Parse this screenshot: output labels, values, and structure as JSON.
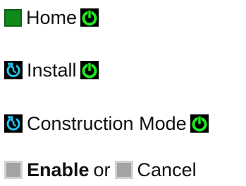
{
  "rows": [
    {
      "label": "Home"
    },
    {
      "label": "Install"
    },
    {
      "label": "Construction Mode"
    }
  ],
  "actions": {
    "enable": "Enable",
    "or": "or",
    "cancel": "Cancel"
  },
  "colors": {
    "status_green": "#118a1c",
    "bright_green": "#1ee81e",
    "cyan": "#21c4f0",
    "gray": "#a3a3a3"
  },
  "icons": {
    "home_status": "green-square-icon",
    "running": "refresh-cycle-icon",
    "ok": "green-power-icon",
    "checkbox": "gray-square-icon"
  }
}
